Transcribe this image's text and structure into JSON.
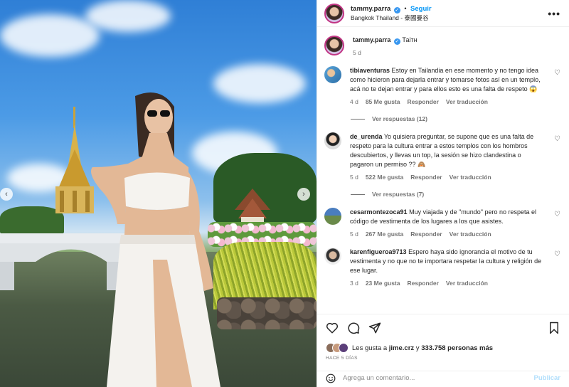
{
  "header": {
    "username": "tammy.parra",
    "follow_label": "Seguir",
    "location": "Bangkok Thailand - 泰國曼谷",
    "separator": "•"
  },
  "caption": {
    "username": "tammy.parra",
    "text": "Таітн",
    "time": "5 d"
  },
  "comments": [
    {
      "username": "tibiaventuras",
      "text": "Estoy en Tailandia en ese momento y no tengo idea como hicieron para dejarla entrar y tomarse fotos así en un templo, acá no te dejan entrar y para ellos esto es una falta de respeto 😱",
      "time": "4 d",
      "likes": "85 Me gusta",
      "reply": "Responder",
      "translate": "Ver traducción",
      "view_replies": "Ver respuestas (12)"
    },
    {
      "username": "de_urenda",
      "text": "Yo quisiera preguntar, se supone que es una falta de respeto para la cultura entrar a estos templos con los hombros descubiertos, y llevas un top, la sesión se hizo clandestina o pagaron un permiso ?? 🙈",
      "time": "5 d",
      "likes": "522 Me gusta",
      "reply": "Responder",
      "translate": "Ver traducción",
      "view_replies": "Ver respuestas (7)"
    },
    {
      "username": "cesarmontezoca91",
      "text": "Muy viajada y de \"mundo\" pero no respeta el código de vestimenta de los lugares a los que asistes.",
      "time": "5 d",
      "likes": "267 Me gusta",
      "reply": "Responder",
      "translate": "Ver traducción"
    },
    {
      "username": "karenfigueroa9713",
      "text": "Espero haya sido ignorancia el motivo de tu vestimenta y no que no te importara respetar la cultura y religión de ese lugar.",
      "time": "3 d",
      "likes": "23 Me gusta",
      "reply": "Responder",
      "translate": "Ver traducción"
    }
  ],
  "likes_summary": {
    "prefix": "Les gusta a",
    "user": "jime.crz",
    "middle": "y",
    "count": "333.758 personas más"
  },
  "posted_ago": "HACE 5 DÍAS",
  "add_comment": {
    "placeholder": "Agrega un comentario...",
    "publish_label": "Publicar"
  },
  "carousel": {
    "prev": "‹",
    "next": "›"
  },
  "icons": {
    "verified": "✓",
    "heart": "♡",
    "more": "•••"
  },
  "colors": {
    "link_blue": "#0095f6",
    "verified_blue": "#3897f0",
    "muted": "#737373"
  }
}
